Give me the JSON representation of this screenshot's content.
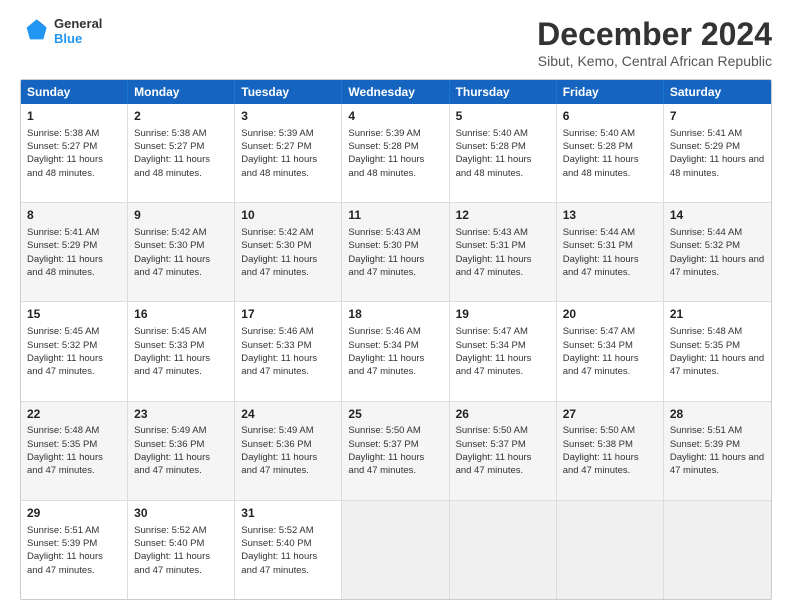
{
  "logo": {
    "line1": "General",
    "line2": "Blue"
  },
  "title": "December 2024",
  "subtitle": "Sibut, Kemo, Central African Republic",
  "weekdays": [
    "Sunday",
    "Monday",
    "Tuesday",
    "Wednesday",
    "Thursday",
    "Friday",
    "Saturday"
  ],
  "weeks": [
    [
      {
        "day": "1",
        "sunrise": "Sunrise: 5:38 AM",
        "sunset": "Sunset: 5:27 PM",
        "daylight": "Daylight: 11 hours and 48 minutes."
      },
      {
        "day": "2",
        "sunrise": "Sunrise: 5:38 AM",
        "sunset": "Sunset: 5:27 PM",
        "daylight": "Daylight: 11 hours and 48 minutes."
      },
      {
        "day": "3",
        "sunrise": "Sunrise: 5:39 AM",
        "sunset": "Sunset: 5:27 PM",
        "daylight": "Daylight: 11 hours and 48 minutes."
      },
      {
        "day": "4",
        "sunrise": "Sunrise: 5:39 AM",
        "sunset": "Sunset: 5:28 PM",
        "daylight": "Daylight: 11 hours and 48 minutes."
      },
      {
        "day": "5",
        "sunrise": "Sunrise: 5:40 AM",
        "sunset": "Sunset: 5:28 PM",
        "daylight": "Daylight: 11 hours and 48 minutes."
      },
      {
        "day": "6",
        "sunrise": "Sunrise: 5:40 AM",
        "sunset": "Sunset: 5:28 PM",
        "daylight": "Daylight: 11 hours and 48 minutes."
      },
      {
        "day": "7",
        "sunrise": "Sunrise: 5:41 AM",
        "sunset": "Sunset: 5:29 PM",
        "daylight": "Daylight: 11 hours and 48 minutes."
      }
    ],
    [
      {
        "day": "8",
        "sunrise": "Sunrise: 5:41 AM",
        "sunset": "Sunset: 5:29 PM",
        "daylight": "Daylight: 11 hours and 48 minutes."
      },
      {
        "day": "9",
        "sunrise": "Sunrise: 5:42 AM",
        "sunset": "Sunset: 5:30 PM",
        "daylight": "Daylight: 11 hours and 47 minutes."
      },
      {
        "day": "10",
        "sunrise": "Sunrise: 5:42 AM",
        "sunset": "Sunset: 5:30 PM",
        "daylight": "Daylight: 11 hours and 47 minutes."
      },
      {
        "day": "11",
        "sunrise": "Sunrise: 5:43 AM",
        "sunset": "Sunset: 5:30 PM",
        "daylight": "Daylight: 11 hours and 47 minutes."
      },
      {
        "day": "12",
        "sunrise": "Sunrise: 5:43 AM",
        "sunset": "Sunset: 5:31 PM",
        "daylight": "Daylight: 11 hours and 47 minutes."
      },
      {
        "day": "13",
        "sunrise": "Sunrise: 5:44 AM",
        "sunset": "Sunset: 5:31 PM",
        "daylight": "Daylight: 11 hours and 47 minutes."
      },
      {
        "day": "14",
        "sunrise": "Sunrise: 5:44 AM",
        "sunset": "Sunset: 5:32 PM",
        "daylight": "Daylight: 11 hours and 47 minutes."
      }
    ],
    [
      {
        "day": "15",
        "sunrise": "Sunrise: 5:45 AM",
        "sunset": "Sunset: 5:32 PM",
        "daylight": "Daylight: 11 hours and 47 minutes."
      },
      {
        "day": "16",
        "sunrise": "Sunrise: 5:45 AM",
        "sunset": "Sunset: 5:33 PM",
        "daylight": "Daylight: 11 hours and 47 minutes."
      },
      {
        "day": "17",
        "sunrise": "Sunrise: 5:46 AM",
        "sunset": "Sunset: 5:33 PM",
        "daylight": "Daylight: 11 hours and 47 minutes."
      },
      {
        "day": "18",
        "sunrise": "Sunrise: 5:46 AM",
        "sunset": "Sunset: 5:34 PM",
        "daylight": "Daylight: 11 hours and 47 minutes."
      },
      {
        "day": "19",
        "sunrise": "Sunrise: 5:47 AM",
        "sunset": "Sunset: 5:34 PM",
        "daylight": "Daylight: 11 hours and 47 minutes."
      },
      {
        "day": "20",
        "sunrise": "Sunrise: 5:47 AM",
        "sunset": "Sunset: 5:34 PM",
        "daylight": "Daylight: 11 hours and 47 minutes."
      },
      {
        "day": "21",
        "sunrise": "Sunrise: 5:48 AM",
        "sunset": "Sunset: 5:35 PM",
        "daylight": "Daylight: 11 hours and 47 minutes."
      }
    ],
    [
      {
        "day": "22",
        "sunrise": "Sunrise: 5:48 AM",
        "sunset": "Sunset: 5:35 PM",
        "daylight": "Daylight: 11 hours and 47 minutes."
      },
      {
        "day": "23",
        "sunrise": "Sunrise: 5:49 AM",
        "sunset": "Sunset: 5:36 PM",
        "daylight": "Daylight: 11 hours and 47 minutes."
      },
      {
        "day": "24",
        "sunrise": "Sunrise: 5:49 AM",
        "sunset": "Sunset: 5:36 PM",
        "daylight": "Daylight: 11 hours and 47 minutes."
      },
      {
        "day": "25",
        "sunrise": "Sunrise: 5:50 AM",
        "sunset": "Sunset: 5:37 PM",
        "daylight": "Daylight: 11 hours and 47 minutes."
      },
      {
        "day": "26",
        "sunrise": "Sunrise: 5:50 AM",
        "sunset": "Sunset: 5:37 PM",
        "daylight": "Daylight: 11 hours and 47 minutes."
      },
      {
        "day": "27",
        "sunrise": "Sunrise: 5:50 AM",
        "sunset": "Sunset: 5:38 PM",
        "daylight": "Daylight: 11 hours and 47 minutes."
      },
      {
        "day": "28",
        "sunrise": "Sunrise: 5:51 AM",
        "sunset": "Sunset: 5:39 PM",
        "daylight": "Daylight: 11 hours and 47 minutes."
      }
    ],
    [
      {
        "day": "29",
        "sunrise": "Sunrise: 5:51 AM",
        "sunset": "Sunset: 5:39 PM",
        "daylight": "Daylight: 11 hours and 47 minutes."
      },
      {
        "day": "30",
        "sunrise": "Sunrise: 5:52 AM",
        "sunset": "Sunset: 5:40 PM",
        "daylight": "Daylight: 11 hours and 47 minutes."
      },
      {
        "day": "31",
        "sunrise": "Sunrise: 5:52 AM",
        "sunset": "Sunset: 5:40 PM",
        "daylight": "Daylight: 11 hours and 47 minutes."
      },
      {
        "day": "",
        "sunrise": "",
        "sunset": "",
        "daylight": ""
      },
      {
        "day": "",
        "sunrise": "",
        "sunset": "",
        "daylight": ""
      },
      {
        "day": "",
        "sunrise": "",
        "sunset": "",
        "daylight": ""
      },
      {
        "day": "",
        "sunrise": "",
        "sunset": "",
        "daylight": ""
      }
    ]
  ]
}
